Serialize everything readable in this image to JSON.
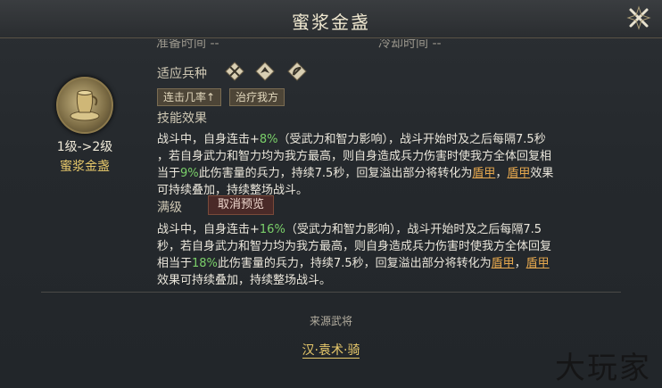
{
  "header": {
    "title": "蜜浆金盏"
  },
  "top_cut": {
    "left": "准备时间  --",
    "right": "冷却时间  --"
  },
  "item": {
    "level": "1级->2级",
    "name": "蜜浆金盏"
  },
  "troops": {
    "label": "适应兵种",
    "icons": [
      "cavalry-icon",
      "shield-icon",
      "bow-icon"
    ]
  },
  "tags": [
    "连击几率↑",
    "治疗我方"
  ],
  "effect": {
    "label": "技能效果",
    "line1": [
      "战斗中，自身连击+",
      "8%",
      "（受武力和智力影响），战斗开始时及之后每隔7.5秒"
    ],
    "line2": "，若自身武力和智力均为我方最高，则自身造成兵力伤害时使我方全体回复相",
    "line3": [
      "当于",
      "9%",
      "此伤害量的兵力，持续7.5秒，回复溢出部分将转化为",
      "盾甲",
      "，",
      "盾甲",
      "效果"
    ],
    "line4": "可持续叠加，持续整场战斗。"
  },
  "max": {
    "label": "满级",
    "preview_button": "取消预览",
    "line1": [
      "战斗中，自身连击+",
      "16%",
      "（受武力和智力影响），战斗开始时及之后每隔7.5"
    ],
    "line2": "秒，若自身武力和智力均为我方最高，则自身造成兵力伤害时使我方全体回复",
    "line3": [
      "相当于",
      "18%",
      "此伤害量的兵力，持续7.5秒，回复溢出部分将转化为",
      "盾甲",
      "，",
      "盾甲"
    ],
    "line4": "效果可持续叠加，持续整场战斗。"
  },
  "source": {
    "title": "来源武将",
    "general": "汉·袁术·骑"
  },
  "watermark": "大玩家"
}
